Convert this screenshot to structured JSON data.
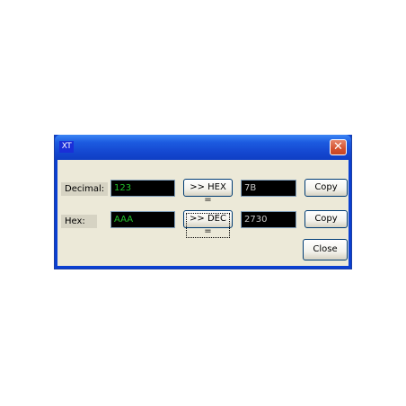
{
  "window": {
    "title_icon": "XT",
    "close_glyph": "✕"
  },
  "decimal": {
    "label": "Decimal:",
    "input": "123",
    "convert_label": ">> HEX =",
    "result": "7B",
    "copy_label": "Copy"
  },
  "hex": {
    "label": "Hex:",
    "input": "AAA",
    "convert_label": ">> DEC =",
    "result": "2730",
    "copy_label": "Copy"
  },
  "close_label": "Close",
  "colors": {
    "input_text": "#22c32c",
    "output_text": "#c8c8c8",
    "titlebar": "#1c5be0",
    "close_button": "#d5522f"
  }
}
